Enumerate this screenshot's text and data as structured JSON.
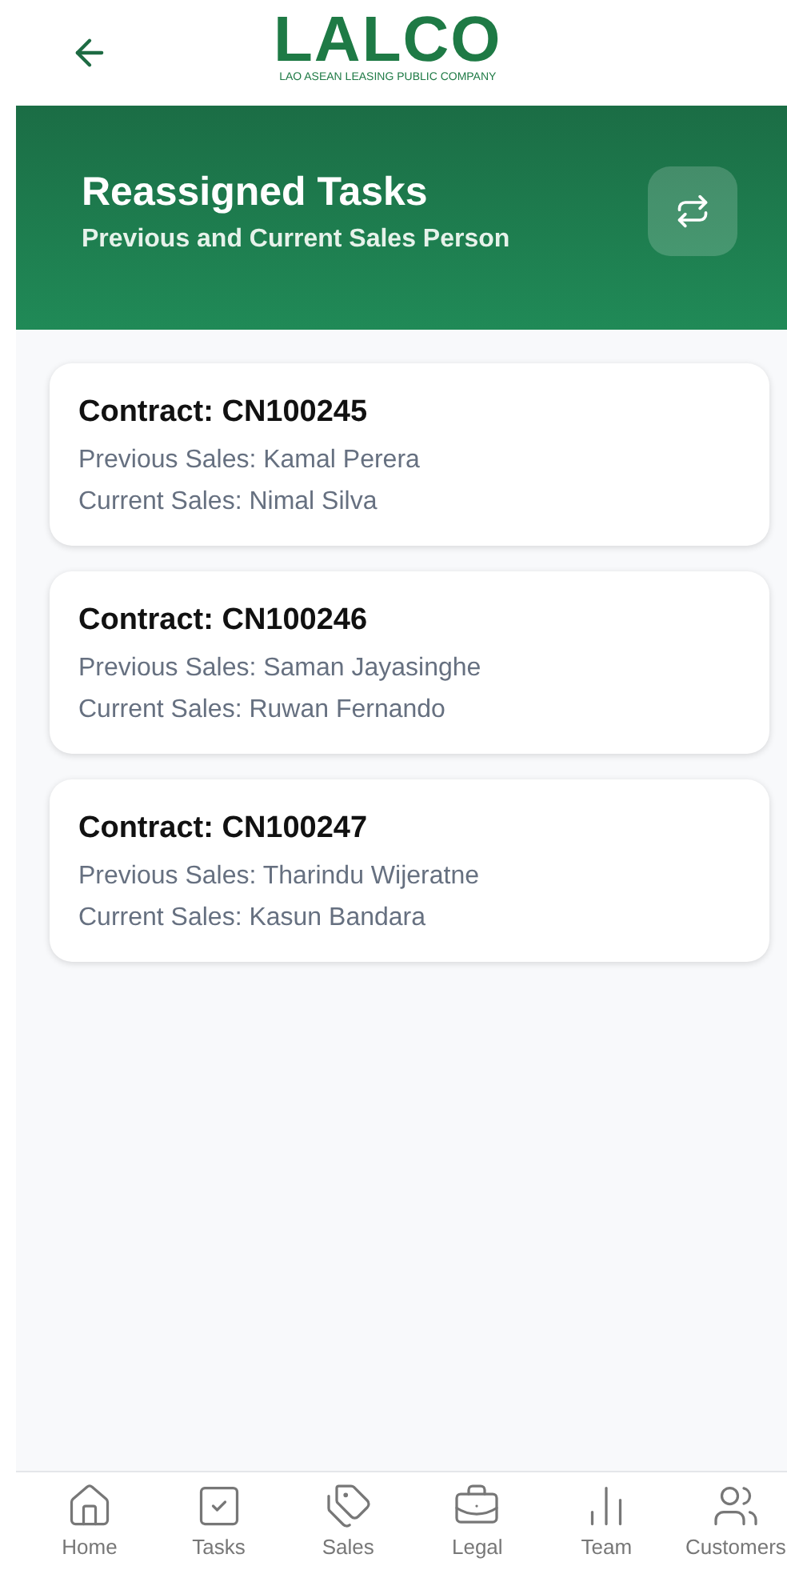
{
  "header": {
    "logo": "LALCO",
    "logo_tagline": "LAO ASEAN LEASING PUBLIC COMPANY"
  },
  "banner": {
    "title": "Reassigned Tasks",
    "subtitle": "Previous and Current Sales Person"
  },
  "contracts": [
    {
      "contract": "Contract: CN100245",
      "previous": "Previous Sales: Kamal Perera",
      "current": "Current Sales: Nimal Silva"
    },
    {
      "contract": "Contract: CN100246",
      "previous": "Previous Sales: Saman Jayasinghe",
      "current": "Current Sales: Ruwan Fernando"
    },
    {
      "contract": "Contract: CN100247",
      "previous": "Previous Sales: Tharindu Wijeratne",
      "current": "Current Sales: Kasun Bandara"
    }
  ],
  "nav": [
    {
      "kind": "home",
      "label": "Home"
    },
    {
      "kind": "tasks",
      "label": "Tasks"
    },
    {
      "kind": "sales",
      "label": "Sales"
    },
    {
      "kind": "legal",
      "label": "Legal"
    },
    {
      "kind": "team",
      "label": "Team"
    },
    {
      "kind": "customers",
      "label": "Customers"
    }
  ]
}
